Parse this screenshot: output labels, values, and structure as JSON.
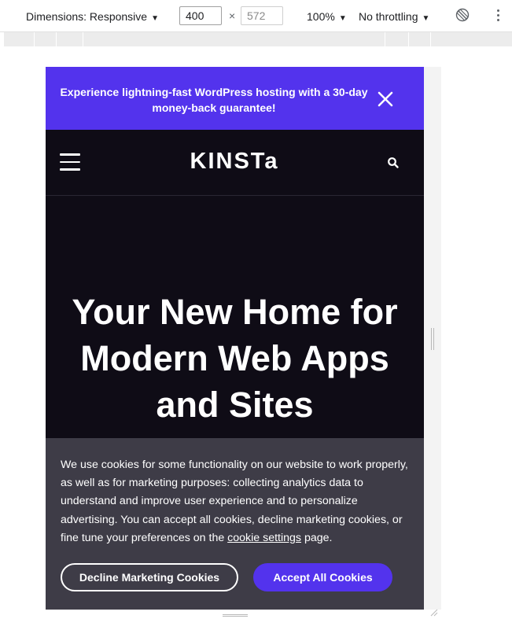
{
  "devtools": {
    "dimensions_label": "Dimensions: Responsive",
    "width_value": "400",
    "height_value": "572",
    "times_symbol": "×",
    "zoom_label": "100%",
    "throttle_label": "No throttling",
    "dropdown_caret": "▼"
  },
  "banner": {
    "text": "Experience lightning-fast WordPress hosting with a 30-day money-back guarantee!",
    "background": "#5333ed"
  },
  "header": {
    "logo": "KINSTa",
    "background": "#0f0c16"
  },
  "hero": {
    "title": "Your New Home for Modern Web Apps and Sites"
  },
  "cookie_notice": {
    "text_before_link": "We use cookies for some functionality on our website to work properly, as well as for marketing purposes: collecting analytics data to understand and improve user experience and to personalize advertising. You can accept all cookies, decline marketing cookies, or fine tune your preferences on the ",
    "link_text": "cookie settings",
    "text_after_link": " page.",
    "decline_label": "Decline Marketing Cookies",
    "accept_label": "Accept All Cookies",
    "background": "#3e3c47"
  },
  "icons": {
    "close": "close-icon",
    "menu": "hamburger-menu-icon",
    "search": "search-icon",
    "rotate": "rotate-icon",
    "more": "more-options-icon"
  }
}
